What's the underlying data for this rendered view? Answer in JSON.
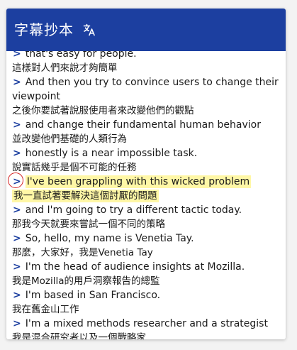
{
  "header": {
    "title": "字幕抄本",
    "translate_icon": "translate-icon"
  },
  "transcript": [
    {
      "en": "that's easy for people.",
      "zh": "這樣對人們來說才夠簡單",
      "active": false
    },
    {
      "en": "And then you try to convince users to change their viewpoint",
      "zh": "之後你要試著說服使用者來改變他們的觀點",
      "active": false
    },
    {
      "en": "and change their fundamental human behavior",
      "zh": "並改變他們基礎的人類行為",
      "active": false
    },
    {
      "en": "honestly is a near impossible task.",
      "zh": "說實話幾乎是個不可能的任務",
      "active": false
    },
    {
      "en": "I've been grappling with this wicked problem",
      "zh": "我一直試著要解決這個討厭的問題",
      "active": true
    },
    {
      "en": "and I'm going to try a different tactic today.",
      "zh": "那我今天就要來嘗試一個不同的策略",
      "active": false
    },
    {
      "en": "So, hello, my name is Venetia Tay.",
      "zh": "那麼，大家好，我是Venetia Tay",
      "active": false
    },
    {
      "en": "I'm the head of audience insights at Mozilla.",
      "zh": "我是Mozilla的用戶洞察報告的總監",
      "active": false
    },
    {
      "en": "I'm based in San Francisco.",
      "zh": "我在舊金山工作",
      "active": false
    },
    {
      "en": "I'm a mixed methods researcher and a strategist",
      "zh": "我是混合研究者以及一個戰略家",
      "active": false
    }
  ],
  "arrow_glyph": ">",
  "colors": {
    "header_bg": "#1c3fa0",
    "highlight": "#fff7a6",
    "arrow": "#1c3fa0",
    "annotation_circle": "#d32020"
  }
}
